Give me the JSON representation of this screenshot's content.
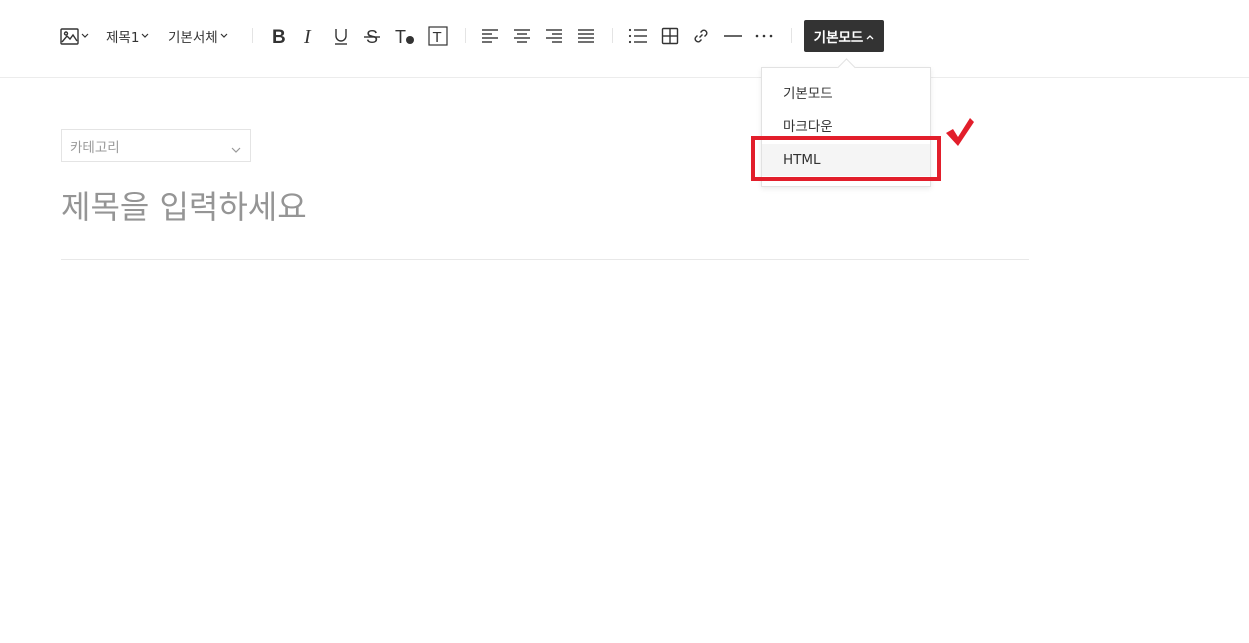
{
  "toolbar": {
    "heading_label": "제목1",
    "font_label": "기본서체",
    "mode_label": "기본모드",
    "icons": [
      "image-icon",
      "bold-icon",
      "italic-icon",
      "underline-icon",
      "strikethrough-icon",
      "text-color-icon",
      "text-background-icon",
      "align-left-icon",
      "align-center-icon",
      "align-right-icon",
      "align-justify-icon",
      "bulleted-list-icon",
      "table-icon",
      "link-icon",
      "horizontal-rule-icon",
      "more-icon"
    ]
  },
  "mode_menu": {
    "items": [
      {
        "label": "기본모드"
      },
      {
        "label": "마크다운"
      },
      {
        "label": "HTML"
      }
    ],
    "highlighted_item": "HTML"
  },
  "annotation": {
    "color": "#e21e2b"
  },
  "editor": {
    "category_placeholder": "카테고리",
    "title_placeholder": "제목을 입력하세요"
  },
  "colors": {
    "mode_button_bg": "#333333",
    "annotation_red": "#e21e2b"
  }
}
